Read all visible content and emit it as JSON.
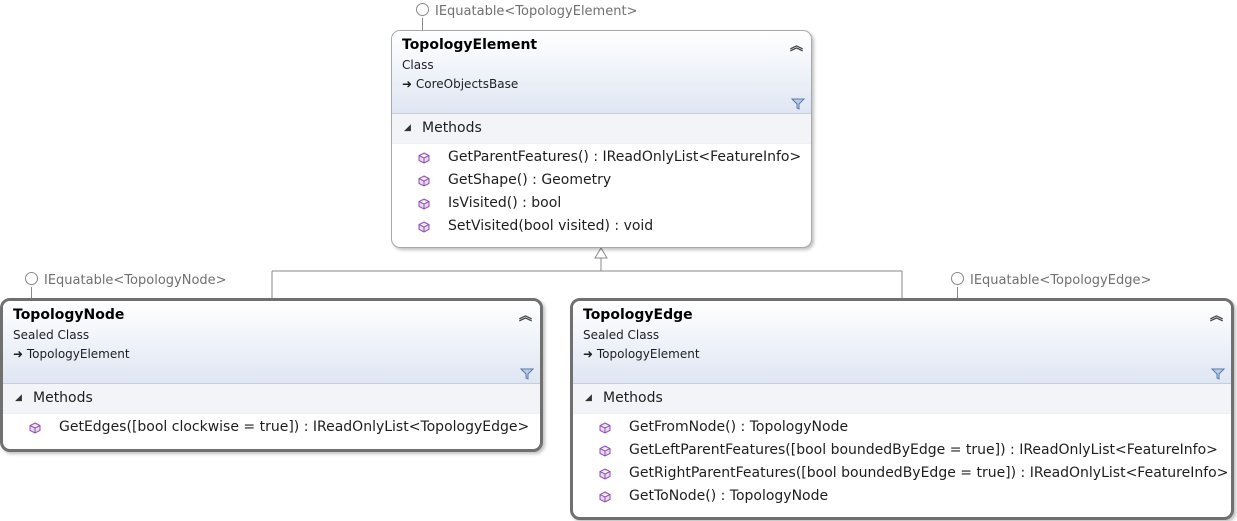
{
  "diagram": {
    "classes": [
      {
        "id": "element",
        "name": "TopologyElement",
        "stereotype": "Class",
        "base": "CoreObjectsBase",
        "interface": "IEquatable<TopologyElement>",
        "section": "Methods",
        "methods": [
          "GetParentFeatures() : IReadOnlyList<FeatureInfo>",
          "GetShape() : Geometry",
          "IsVisited() : bool",
          "SetVisited(bool visited) : void"
        ]
      },
      {
        "id": "node",
        "name": "TopologyNode",
        "stereotype": "Sealed Class",
        "base": "TopologyElement",
        "interface": "IEquatable<TopologyNode>",
        "section": "Methods",
        "methods": [
          "GetEdges([bool clockwise = true]) : IReadOnlyList<TopologyEdge>"
        ]
      },
      {
        "id": "edge",
        "name": "TopologyEdge",
        "stereotype": "Sealed Class",
        "base": "TopologyElement",
        "interface": "IEquatable<TopologyEdge>",
        "section": "Methods",
        "methods": [
          "GetFromNode() : TopologyNode",
          "GetLeftParentFeatures([bool boundedByEdge = true]) : IReadOnlyList<FeatureInfo>",
          "GetRightParentFeatures([bool boundedByEdge = true]) : IReadOnlyList<FeatureInfo>",
          "GetToNode() : TopologyNode"
        ]
      }
    ],
    "icons": {
      "collapse": "double-chevron-up-icon",
      "filter": "filter-icon",
      "method": "method-cube-icon",
      "inherits": "inheritance-arrow-icon",
      "interface": "interface-lollipop-icon"
    },
    "colors": {
      "header_gradient_bottom": "#dfe6f3",
      "method_icon": "#8e4fb0",
      "selected_border": "#707070"
    }
  }
}
